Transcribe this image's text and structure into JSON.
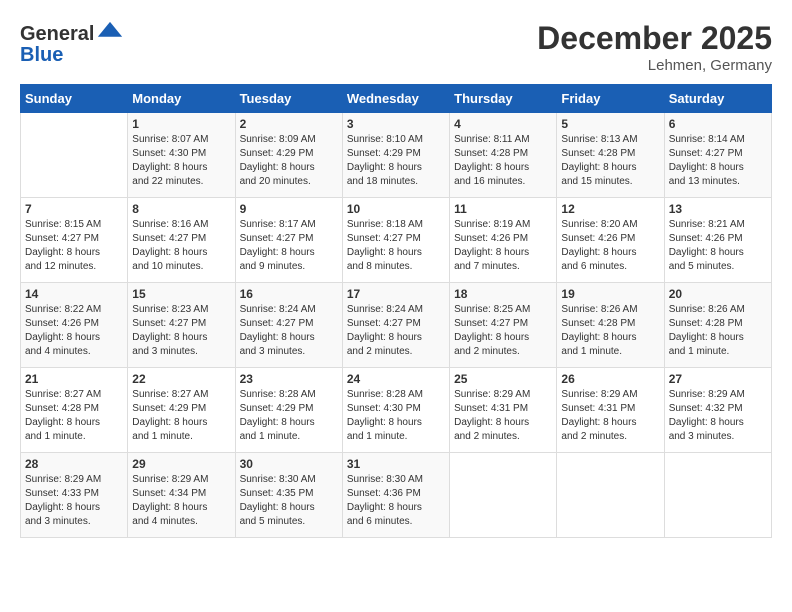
{
  "header": {
    "logo_line1": "General",
    "logo_line2": "Blue",
    "month_title": "December 2025",
    "location": "Lehmen, Germany"
  },
  "days_of_week": [
    "Sunday",
    "Monday",
    "Tuesday",
    "Wednesday",
    "Thursday",
    "Friday",
    "Saturday"
  ],
  "weeks": [
    [
      {
        "day": "",
        "info": ""
      },
      {
        "day": "1",
        "info": "Sunrise: 8:07 AM\nSunset: 4:30 PM\nDaylight: 8 hours\nand 22 minutes."
      },
      {
        "day": "2",
        "info": "Sunrise: 8:09 AM\nSunset: 4:29 PM\nDaylight: 8 hours\nand 20 minutes."
      },
      {
        "day": "3",
        "info": "Sunrise: 8:10 AM\nSunset: 4:29 PM\nDaylight: 8 hours\nand 18 minutes."
      },
      {
        "day": "4",
        "info": "Sunrise: 8:11 AM\nSunset: 4:28 PM\nDaylight: 8 hours\nand 16 minutes."
      },
      {
        "day": "5",
        "info": "Sunrise: 8:13 AM\nSunset: 4:28 PM\nDaylight: 8 hours\nand 15 minutes."
      },
      {
        "day": "6",
        "info": "Sunrise: 8:14 AM\nSunset: 4:27 PM\nDaylight: 8 hours\nand 13 minutes."
      }
    ],
    [
      {
        "day": "7",
        "info": "Sunrise: 8:15 AM\nSunset: 4:27 PM\nDaylight: 8 hours\nand 12 minutes."
      },
      {
        "day": "8",
        "info": "Sunrise: 8:16 AM\nSunset: 4:27 PM\nDaylight: 8 hours\nand 10 minutes."
      },
      {
        "day": "9",
        "info": "Sunrise: 8:17 AM\nSunset: 4:27 PM\nDaylight: 8 hours\nand 9 minutes."
      },
      {
        "day": "10",
        "info": "Sunrise: 8:18 AM\nSunset: 4:27 PM\nDaylight: 8 hours\nand 8 minutes."
      },
      {
        "day": "11",
        "info": "Sunrise: 8:19 AM\nSunset: 4:26 PM\nDaylight: 8 hours\nand 7 minutes."
      },
      {
        "day": "12",
        "info": "Sunrise: 8:20 AM\nSunset: 4:26 PM\nDaylight: 8 hours\nand 6 minutes."
      },
      {
        "day": "13",
        "info": "Sunrise: 8:21 AM\nSunset: 4:26 PM\nDaylight: 8 hours\nand 5 minutes."
      }
    ],
    [
      {
        "day": "14",
        "info": "Sunrise: 8:22 AM\nSunset: 4:26 PM\nDaylight: 8 hours\nand 4 minutes."
      },
      {
        "day": "15",
        "info": "Sunrise: 8:23 AM\nSunset: 4:27 PM\nDaylight: 8 hours\nand 3 minutes."
      },
      {
        "day": "16",
        "info": "Sunrise: 8:24 AM\nSunset: 4:27 PM\nDaylight: 8 hours\nand 3 minutes."
      },
      {
        "day": "17",
        "info": "Sunrise: 8:24 AM\nSunset: 4:27 PM\nDaylight: 8 hours\nand 2 minutes."
      },
      {
        "day": "18",
        "info": "Sunrise: 8:25 AM\nSunset: 4:27 PM\nDaylight: 8 hours\nand 2 minutes."
      },
      {
        "day": "19",
        "info": "Sunrise: 8:26 AM\nSunset: 4:28 PM\nDaylight: 8 hours\nand 1 minute."
      },
      {
        "day": "20",
        "info": "Sunrise: 8:26 AM\nSunset: 4:28 PM\nDaylight: 8 hours\nand 1 minute."
      }
    ],
    [
      {
        "day": "21",
        "info": "Sunrise: 8:27 AM\nSunset: 4:28 PM\nDaylight: 8 hours\nand 1 minute."
      },
      {
        "day": "22",
        "info": "Sunrise: 8:27 AM\nSunset: 4:29 PM\nDaylight: 8 hours\nand 1 minute."
      },
      {
        "day": "23",
        "info": "Sunrise: 8:28 AM\nSunset: 4:29 PM\nDaylight: 8 hours\nand 1 minute."
      },
      {
        "day": "24",
        "info": "Sunrise: 8:28 AM\nSunset: 4:30 PM\nDaylight: 8 hours\nand 1 minute."
      },
      {
        "day": "25",
        "info": "Sunrise: 8:29 AM\nSunset: 4:31 PM\nDaylight: 8 hours\nand 2 minutes."
      },
      {
        "day": "26",
        "info": "Sunrise: 8:29 AM\nSunset: 4:31 PM\nDaylight: 8 hours\nand 2 minutes."
      },
      {
        "day": "27",
        "info": "Sunrise: 8:29 AM\nSunset: 4:32 PM\nDaylight: 8 hours\nand 3 minutes."
      }
    ],
    [
      {
        "day": "28",
        "info": "Sunrise: 8:29 AM\nSunset: 4:33 PM\nDaylight: 8 hours\nand 3 minutes."
      },
      {
        "day": "29",
        "info": "Sunrise: 8:29 AM\nSunset: 4:34 PM\nDaylight: 8 hours\nand 4 minutes."
      },
      {
        "day": "30",
        "info": "Sunrise: 8:30 AM\nSunset: 4:35 PM\nDaylight: 8 hours\nand 5 minutes."
      },
      {
        "day": "31",
        "info": "Sunrise: 8:30 AM\nSunset: 4:36 PM\nDaylight: 8 hours\nand 6 minutes."
      },
      {
        "day": "",
        "info": ""
      },
      {
        "day": "",
        "info": ""
      },
      {
        "day": "",
        "info": ""
      }
    ]
  ]
}
